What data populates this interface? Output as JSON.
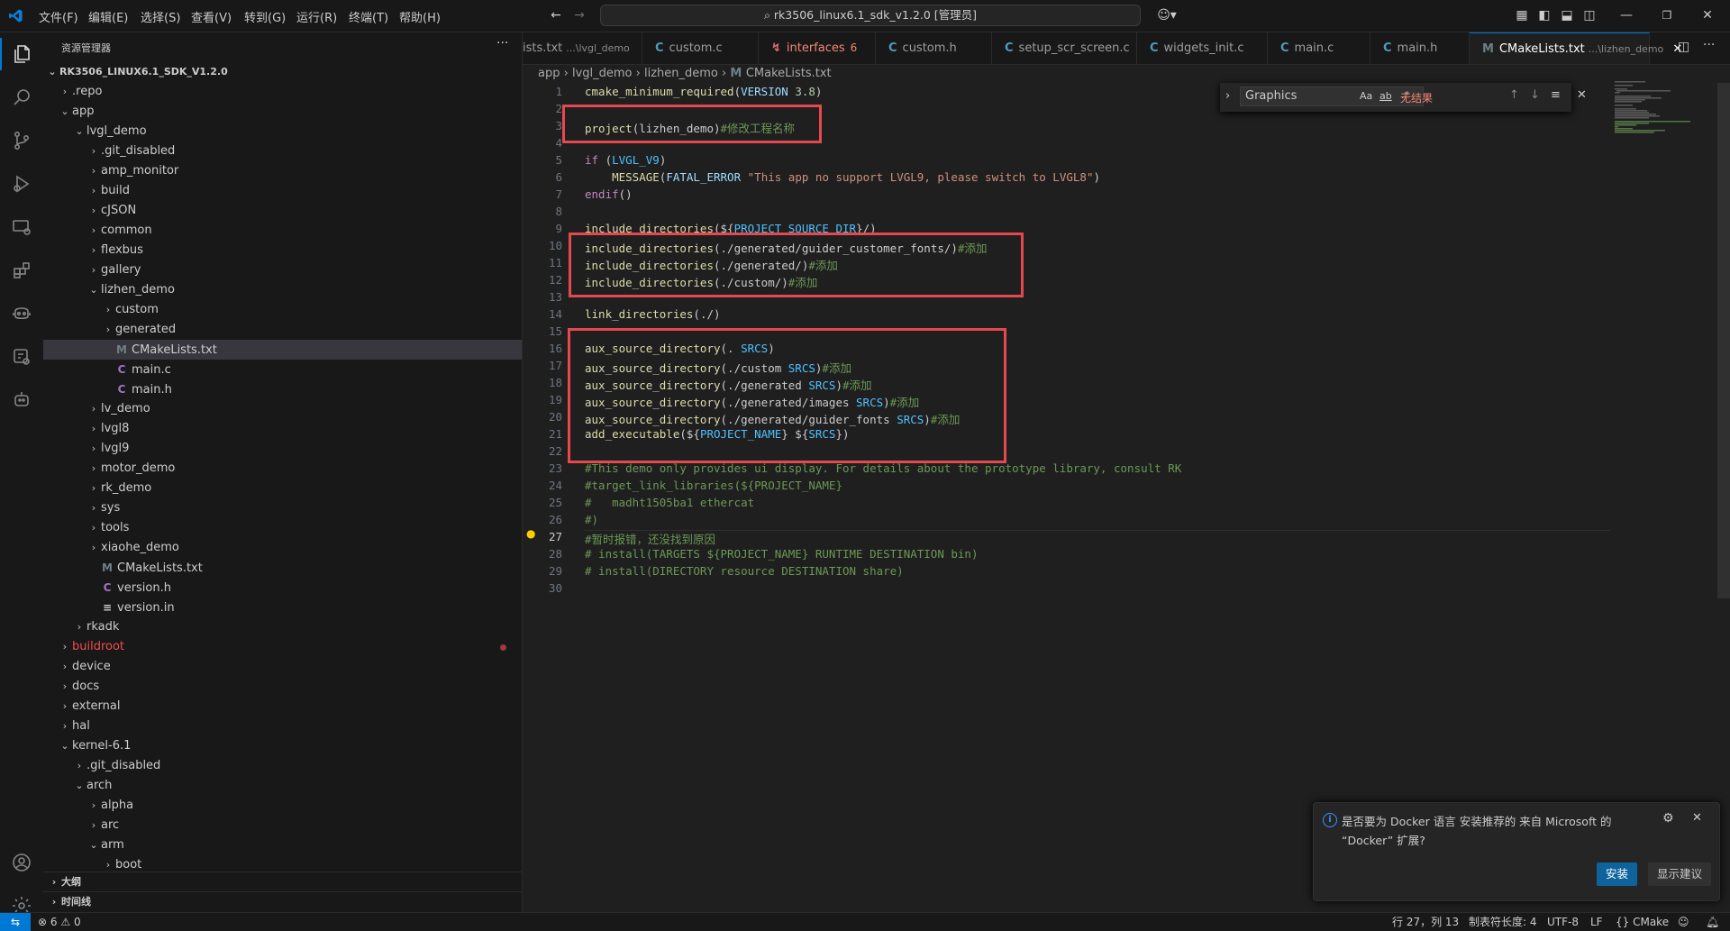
{
  "window": {
    "menu": [
      "文件(F)",
      "编辑(E)",
      "选择(S)",
      "查看(V)",
      "转到(G)",
      "运行(R)",
      "终端(T)",
      "帮助(H)"
    ],
    "command_center": "rk3506_linux6.1_sdk_v1.2.0 [管理员]"
  },
  "sidebar": {
    "header": "资源管理器",
    "root": "RK3506_LINUX6.1_SDK_V1.2.0",
    "tree": [
      {
        "label": ".repo",
        "depth": 1,
        "kind": "folder",
        "open": false
      },
      {
        "label": "app",
        "depth": 1,
        "kind": "folder",
        "open": true
      },
      {
        "label": "lvgl_demo",
        "depth": 2,
        "kind": "folder",
        "open": true
      },
      {
        "label": ".git_disabled",
        "depth": 3,
        "kind": "folder",
        "open": false
      },
      {
        "label": "amp_monitor",
        "depth": 3,
        "kind": "folder",
        "open": false
      },
      {
        "label": "build",
        "depth": 3,
        "kind": "folder",
        "open": false
      },
      {
        "label": "cJSON",
        "depth": 3,
        "kind": "folder",
        "open": false
      },
      {
        "label": "common",
        "depth": 3,
        "kind": "folder",
        "open": false
      },
      {
        "label": "flexbus",
        "depth": 3,
        "kind": "folder",
        "open": false
      },
      {
        "label": "gallery",
        "depth": 3,
        "kind": "folder",
        "open": false
      },
      {
        "label": "lizhen_demo",
        "depth": 3,
        "kind": "folder",
        "open": true
      },
      {
        "label": "custom",
        "depth": 4,
        "kind": "folder",
        "open": false
      },
      {
        "label": "generated",
        "depth": 4,
        "kind": "folder",
        "open": false
      },
      {
        "label": "CMakeLists.txt",
        "depth": 4,
        "kind": "m",
        "selected": true
      },
      {
        "label": "main.c",
        "depth": 4,
        "kind": "c"
      },
      {
        "label": "main.h",
        "depth": 4,
        "kind": "c"
      },
      {
        "label": "lv_demo",
        "depth": 3,
        "kind": "folder",
        "open": false
      },
      {
        "label": "lvgl8",
        "depth": 3,
        "kind": "folder",
        "open": false
      },
      {
        "label": "lvgl9",
        "depth": 3,
        "kind": "folder",
        "open": false
      },
      {
        "label": "motor_demo",
        "depth": 3,
        "kind": "folder",
        "open": false
      },
      {
        "label": "rk_demo",
        "depth": 3,
        "kind": "folder",
        "open": false
      },
      {
        "label": "sys",
        "depth": 3,
        "kind": "folder",
        "open": false
      },
      {
        "label": "tools",
        "depth": 3,
        "kind": "folder",
        "open": false
      },
      {
        "label": "xiaohe_demo",
        "depth": 3,
        "kind": "folder",
        "open": false
      },
      {
        "label": "CMakeLists.txt",
        "depth": 3,
        "kind": "m"
      },
      {
        "label": "version.h",
        "depth": 3,
        "kind": "c"
      },
      {
        "label": "version.in",
        "depth": 3,
        "kind": "eq"
      },
      {
        "label": "rkadk",
        "depth": 2,
        "kind": "folder",
        "open": false
      },
      {
        "label": "buildroot",
        "depth": 1,
        "kind": "folder",
        "open": false,
        "modified": true
      },
      {
        "label": "device",
        "depth": 1,
        "kind": "folder",
        "open": false
      },
      {
        "label": "docs",
        "depth": 1,
        "kind": "folder",
        "open": false
      },
      {
        "label": "external",
        "depth": 1,
        "kind": "folder",
        "open": false
      },
      {
        "label": "hal",
        "depth": 1,
        "kind": "folder",
        "open": false
      },
      {
        "label": "kernel-6.1",
        "depth": 1,
        "kind": "folder",
        "open": true
      },
      {
        "label": ".git_disabled",
        "depth": 2,
        "kind": "folder",
        "open": false
      },
      {
        "label": "arch",
        "depth": 2,
        "kind": "folder",
        "open": true
      },
      {
        "label": "alpha",
        "depth": 3,
        "kind": "folder",
        "open": false
      },
      {
        "label": "arc",
        "depth": 3,
        "kind": "folder",
        "open": false
      },
      {
        "label": "arm",
        "depth": 3,
        "kind": "folder",
        "open": true
      },
      {
        "label": "boot",
        "depth": 4,
        "kind": "folder",
        "open": false
      }
    ],
    "outline_label": "大纲",
    "timeline_label": "时间线"
  },
  "tabs": [
    {
      "label": "ists.txt",
      "desc": "...\\lvgl_demo",
      "icon": "none"
    },
    {
      "label": "custom.c",
      "icon": "c"
    },
    {
      "label": "interfaces",
      "badge": "6",
      "icon": "err"
    },
    {
      "label": "custom.h",
      "icon": "c"
    },
    {
      "label": "setup_scr_screen.c",
      "icon": "c"
    },
    {
      "label": "widgets_init.c",
      "icon": "c"
    },
    {
      "label": "main.c",
      "icon": "c"
    },
    {
      "label": "main.h",
      "icon": "c"
    },
    {
      "label": "CMakeLists.txt",
      "desc": "...\\lizhen_demo",
      "icon": "m",
      "active": true
    }
  ],
  "breadcrumb": [
    "app",
    "lvgl_demo",
    "lizhen_demo",
    "CMakeLists.txt"
  ],
  "find": {
    "value": "Graphics",
    "result": "无结果",
    "opt_case": "Aa",
    "opt_word": "ab",
    "opt_regex": ".*"
  },
  "code": [
    "cmake_minimum_required(VERSION 3.8)",
    "",
    "project(lizhen_demo)#修改工程名称",
    "",
    "if (LVGL_V9)",
    "    MESSAGE(FATAL_ERROR \"This app no support LVGL9, please switch to LVGL8\")",
    "endif()",
    "",
    "include_directories(${PROJECT_SOURCE_DIR}/)",
    "include_directories(./generated/guider_customer_fonts/)#添加",
    "include_directories(./generated/)#添加",
    "include_directories(./custom/)#添加",
    "",
    "link_directories(./)",
    "",
    "aux_source_directory(. SRCS)",
    "aux_source_directory(./custom SRCS)#添加",
    "aux_source_directory(./generated SRCS)#添加",
    "aux_source_directory(./generated/images SRCS)#添加",
    "aux_source_directory(./generated/guider_fonts SRCS)#添加",
    "add_executable(${PROJECT_NAME} ${SRCS})",
    "",
    "#This demo only provides ui display. For details about the prototype library, consult RK",
    "#target_link_libraries(${PROJECT_NAME}",
    "#   madht1505ba1 ethercat",
    "#)",
    "#暂时报错，还没找到原因",
    "# install(TARGETS ${PROJECT_NAME} RUNTIME DESTINATION bin)",
    "# install(DIRECTORY resource DESTINATION share)",
    ""
  ],
  "current_line": 27,
  "notification": {
    "message": "是否要为 Docker 语言 安装推荐的 来自 Microsoft 的 “Docker” 扩展?",
    "install_label": "安装",
    "show_label": "显示建议"
  },
  "statusbar": {
    "errors": "6",
    "warnings": "0",
    "position": "行 27，列 13",
    "tab_size": "制表符长度: 4",
    "encoding": "UTF-8",
    "eol": "LF",
    "language": "CMake"
  },
  "colors": {
    "accent": "#0078d4",
    "highlight_box": "#e5484d",
    "install_button": "#0e639c"
  }
}
